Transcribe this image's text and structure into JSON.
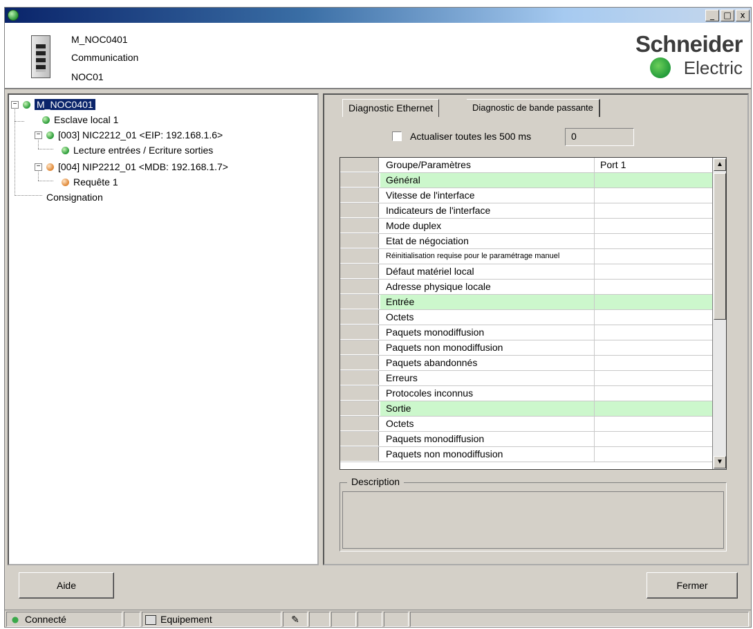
{
  "window": {
    "controls": [
      "_",
      "□",
      "x"
    ]
  },
  "header": {
    "module_name": "M_NOC0401",
    "module_type": "Communication",
    "module_id": "NOC01",
    "logo_line1": "Schneider",
    "logo_line2": "Electric"
  },
  "tree": {
    "root": "M_NOC0401",
    "local_slave": "Esclave local 1",
    "device1": "[003] NIC2212_01 <EIP: 192.168.1.6>",
    "device1_child": "Lecture entrées / Ecriture sorties",
    "device2": "[004] NIP2212_01 <MDB: 192.168.1.7>",
    "device2_child": "Requête 1",
    "log": "Consignation"
  },
  "tabs": {
    "active": "Diagnostic Ethernet",
    "inactive": "Diagnostic de bande passante"
  },
  "refresh": {
    "label": "Actualiser toutes les 500 ms",
    "value": "0",
    "checked": false
  },
  "grid": {
    "col1": "Groupe/Paramètres",
    "col2": "Port 1",
    "rows": [
      {
        "label": "Général",
        "value": "",
        "group": true
      },
      {
        "label": "Vitesse de l'interface",
        "value": ""
      },
      {
        "label": "Indicateurs de l'interface",
        "value": ""
      },
      {
        "label": "Mode duplex",
        "value": ""
      },
      {
        "label": "Etat de négociation",
        "value": ""
      },
      {
        "label": "Réinitialisation requise pour le paramétrage manuel",
        "value": ""
      },
      {
        "label": "Défaut matériel local",
        "value": ""
      },
      {
        "label": "Adresse physique locale",
        "value": ""
      },
      {
        "label": "Entrée",
        "value": "",
        "group": true
      },
      {
        "label": "Octets",
        "value": ""
      },
      {
        "label": "Paquets monodiffusion",
        "value": ""
      },
      {
        "label": "Paquets non monodiffusion",
        "value": ""
      },
      {
        "label": "Paquets abandonnés",
        "value": ""
      },
      {
        "label": "Erreurs",
        "value": ""
      },
      {
        "label": "Protocoles inconnus",
        "value": ""
      },
      {
        "label": "Sortie",
        "value": "",
        "group": true
      },
      {
        "label": "Octets",
        "value": ""
      },
      {
        "label": "Paquets monodiffusion",
        "value": ""
      },
      {
        "label": "Paquets non monodiffusion",
        "value": ""
      }
    ]
  },
  "description": {
    "label": "Description"
  },
  "buttons": {
    "help": "Aide",
    "close": "Fermer"
  },
  "status": {
    "connection": "Connecté",
    "mode": "Equipement"
  },
  "colors": {
    "group_row": "#ccf7cc",
    "selection": "#0a246a",
    "chrome": "#d4d0c8"
  }
}
